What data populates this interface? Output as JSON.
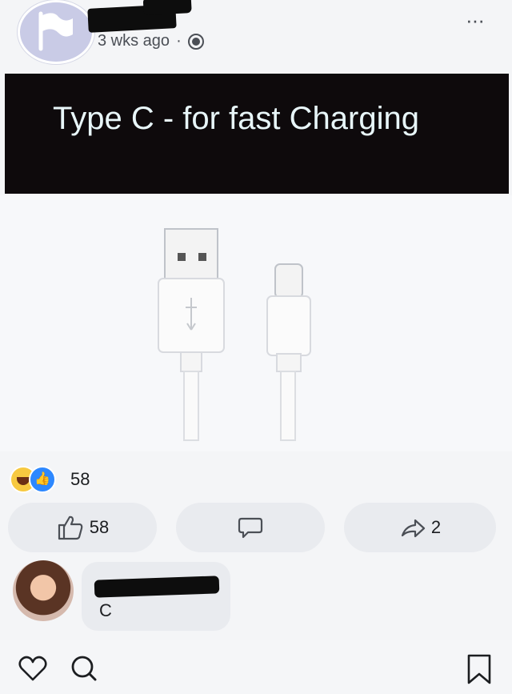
{
  "post": {
    "timestamp": "3 wks ago",
    "separator": "·",
    "more_label": "···",
    "banner_text": "Type C - for fast Charging"
  },
  "reactions": {
    "count": "58"
  },
  "actions": {
    "like_count": "58",
    "share_count": "2"
  },
  "comment": {
    "text": "C"
  },
  "colors": {
    "banner_bg": "#0e0a0c",
    "banner_text": "#e8f6f9",
    "like_blue": "#2d88ff",
    "pill_bg": "#e9ebef"
  }
}
